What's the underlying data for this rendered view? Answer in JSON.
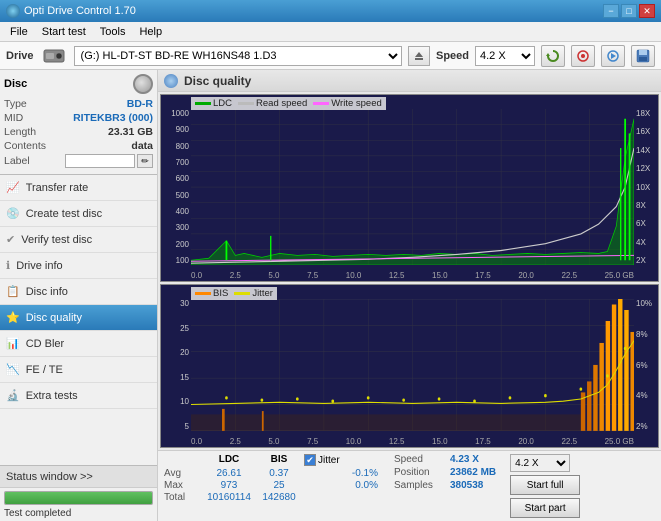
{
  "app": {
    "title": "Opti Drive Control 1.70",
    "title_icon": "disc-icon"
  },
  "titlebar": {
    "minimize_label": "−",
    "maximize_label": "□",
    "close_label": "✕"
  },
  "menu": {
    "items": [
      "File",
      "Start test",
      "Tools",
      "Help"
    ]
  },
  "drive_bar": {
    "label": "Drive",
    "drive_value": "(G:)  HL-DT-ST BD-RE  WH16NS48 1.D3",
    "speed_label": "Speed",
    "speed_value": "4.2 X"
  },
  "disc": {
    "title": "Disc",
    "type_label": "Type",
    "type_value": "BD-R",
    "mid_label": "MID",
    "mid_value": "RITEKBR3 (000)",
    "length_label": "Length",
    "length_value": "23.31 GB",
    "contents_label": "Contents",
    "contents_value": "data",
    "label_label": "Label",
    "label_value": ""
  },
  "nav": {
    "items": [
      {
        "id": "transfer-rate",
        "label": "Transfer rate",
        "icon": "📈"
      },
      {
        "id": "create-test-disc",
        "label": "Create test disc",
        "icon": "💿"
      },
      {
        "id": "verify-test-disc",
        "label": "Verify test disc",
        "icon": "✔"
      },
      {
        "id": "drive-info",
        "label": "Drive info",
        "icon": "ℹ"
      },
      {
        "id": "disc-info",
        "label": "Disc info",
        "icon": "📋"
      },
      {
        "id": "disc-quality",
        "label": "Disc quality",
        "icon": "⭐",
        "active": true
      },
      {
        "id": "cd-bler",
        "label": "CD Bler",
        "icon": "📊"
      },
      {
        "id": "fe-te",
        "label": "FE / TE",
        "icon": "📉"
      },
      {
        "id": "extra-tests",
        "label": "Extra tests",
        "icon": "🔬"
      }
    ]
  },
  "status_window": {
    "label": "Status window >>",
    "progress_percent": 100,
    "status_text": "Test completed"
  },
  "chart": {
    "title": "Disc quality",
    "top_legend": {
      "ldc_label": "LDC",
      "ldc_color": "#00aa00",
      "read_speed_label": "Read speed",
      "read_speed_color": "#aaaaaa",
      "write_speed_label": "Write speed",
      "write_speed_color": "#ff66ff"
    },
    "bottom_legend": {
      "bis_label": "BIS",
      "bis_color": "#ff8800",
      "jitter_label": "Jitter",
      "jitter_color": "#dddd00"
    },
    "top_y_axis": [
      "1000",
      "900",
      "800",
      "700",
      "600",
      "500",
      "400",
      "300",
      "200",
      "100"
    ],
    "top_y_axis_right": [
      "18X",
      "16X",
      "14X",
      "12X",
      "10X",
      "8X",
      "6X",
      "4X",
      "2X"
    ],
    "bottom_y_axis": [
      "30",
      "25",
      "20",
      "15",
      "10",
      "5"
    ],
    "bottom_y_axis_right": [
      "10%",
      "8%",
      "6%",
      "4%",
      "2%"
    ],
    "x_axis": [
      "0.0",
      "2.5",
      "5.0",
      "7.5",
      "10.0",
      "12.5",
      "15.0",
      "17.5",
      "20.0",
      "22.5",
      "25.0 GB"
    ]
  },
  "stats": {
    "ldc_label": "LDC",
    "bis_label": "BIS",
    "jitter_label": "Jitter",
    "jitter_checked": true,
    "avg_label": "Avg",
    "avg_ldc": "26.61",
    "avg_bis": "0.37",
    "avg_jitter": "-0.1%",
    "max_label": "Max",
    "max_ldc": "973",
    "max_bis": "25",
    "max_jitter": "0.0%",
    "total_label": "Total",
    "total_ldc": "10160114",
    "total_bis": "142680",
    "speed_label": "Speed",
    "speed_value": "4.23 X",
    "position_label": "Position",
    "position_value": "23862 MB",
    "samples_label": "Samples",
    "samples_value": "380538",
    "speed_select": "4.2 X",
    "start_full_label": "Start full",
    "start_part_label": "Start part"
  }
}
